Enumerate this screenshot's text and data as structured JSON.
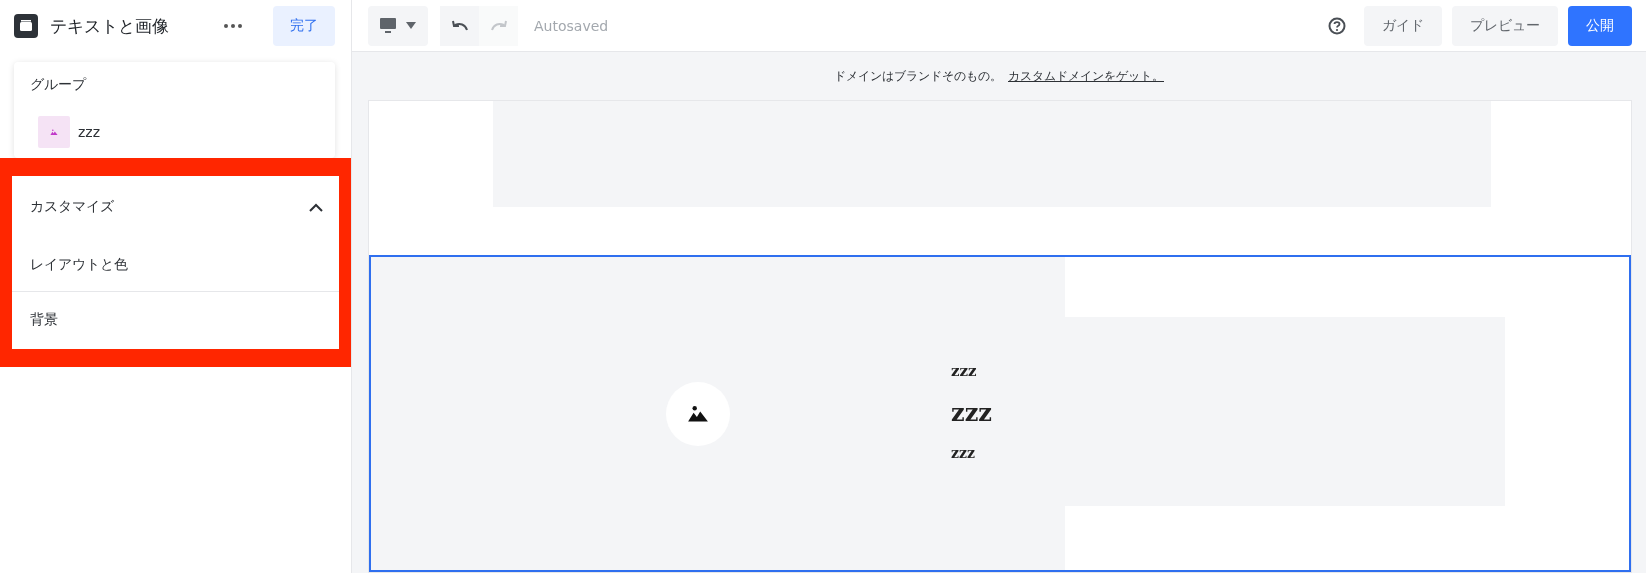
{
  "sidebar": {
    "title": "テキストと画像",
    "done_button": "完了",
    "group": {
      "heading": "グループ",
      "items": [
        {
          "label": "zzz"
        }
      ]
    },
    "customize": {
      "heading": "カスタマイズ",
      "expanded": true,
      "items": [
        "レイアウトと色",
        "背景"
      ]
    }
  },
  "toolbar": {
    "undo_disabled": false,
    "redo_disabled": true,
    "status": "Autosaved",
    "buttons": [
      {
        "label": "ガイド",
        "kind": "secondary"
      },
      {
        "label": "プレビュー",
        "kind": "secondary"
      },
      {
        "label": "公開",
        "kind": "primary"
      }
    ]
  },
  "banner": {
    "text": "ドメインはブランドそのもの。",
    "link": "カスタムドメインをゲット。"
  },
  "section": {
    "selected": true,
    "texts": [
      {
        "kind": "eyebrow",
        "text": "zzz"
      },
      {
        "kind": "title",
        "text": "zzz"
      },
      {
        "kind": "body",
        "text": "zzz"
      }
    ]
  }
}
